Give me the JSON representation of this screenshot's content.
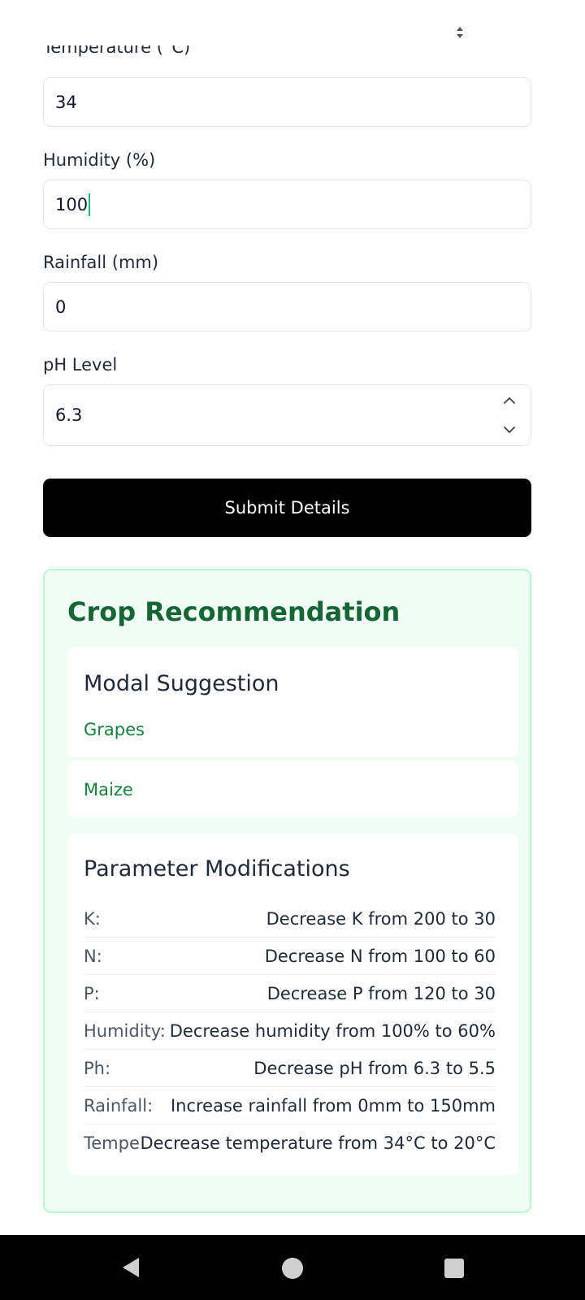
{
  "form": {
    "select_arrows_icon": "sort-arrows",
    "temperature": {
      "label": "Temperature (°C)",
      "value": "34"
    },
    "humidity": {
      "label": "Humidity (%)",
      "value": "100"
    },
    "rainfall": {
      "label": "Rainfall (mm)",
      "value": "0"
    },
    "ph": {
      "label": "pH Level",
      "value": "6.3"
    },
    "submit_label": "Submit Details"
  },
  "recommendation": {
    "title": "Crop Recommendation",
    "model_suggestion": {
      "heading": "Modal Suggestion",
      "crops": [
        "Grapes",
        "Maize"
      ]
    },
    "parameter_modifications": {
      "heading": "Parameter Modifications",
      "rows": [
        {
          "key": "K:",
          "value": "Decrease K from 200 to 30"
        },
        {
          "key": "N:",
          "value": "Decrease N from 100 to 60"
        },
        {
          "key": "P:",
          "value": "Decrease P from 120 to 30"
        },
        {
          "key": "Humidity:",
          "value": "Decrease humidity from 100% to 60%"
        },
        {
          "key": "Ph:",
          "value": "Decrease pH from 6.3 to 5.5"
        },
        {
          "key": "Rainfall:",
          "value": "Increase rainfall from 0mm to 150mm"
        },
        {
          "key": "Tempe",
          "value": "Decrease temperature from 34°C to 20°C"
        }
      ]
    }
  },
  "colors": {
    "accent_green": "#166534",
    "suggestion_green": "#15803d",
    "panel_background": "#f0fdf4",
    "button_background": "#000000"
  },
  "navigation": {
    "icons": [
      "back-triangle",
      "home-circle",
      "recents-square"
    ]
  }
}
